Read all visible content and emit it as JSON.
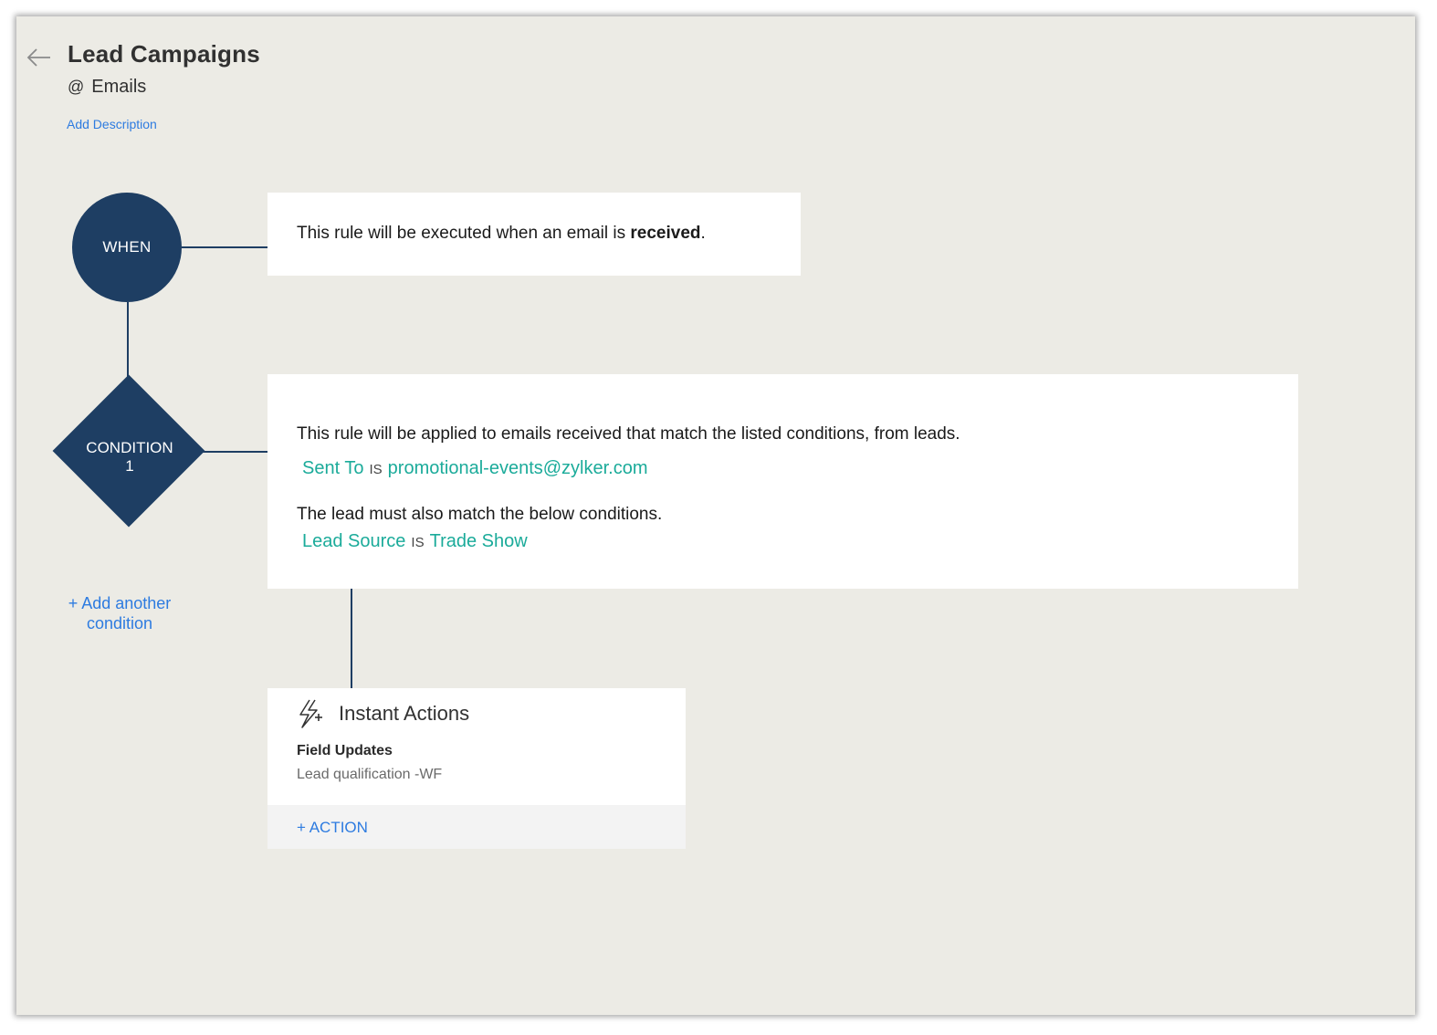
{
  "header": {
    "title": "Lead Campaigns",
    "subtitle_prefix": "@",
    "subtitle": "Emails",
    "add_description": "Add Description"
  },
  "when": {
    "node_label": "WHEN",
    "text_prefix": "This rule will be executed when an email is ",
    "text_bold": "received",
    "text_suffix": "."
  },
  "condition": {
    "node_label_line1": "CONDITION",
    "node_label_line2": "1",
    "intro": "This rule will be applied to emails received that match the listed conditions, from leads.",
    "criteria1": {
      "field": "Sent To",
      "operator": "IS",
      "value": "promotional-events@zylker.com"
    },
    "lead_intro": "The lead must also match the below conditions.",
    "criteria2": {
      "field": "Lead Source",
      "operator": "IS",
      "value": "Trade Show"
    },
    "add_another_line1": "+ Add another",
    "add_another_line2": "condition"
  },
  "actions": {
    "title": "Instant Actions",
    "icon": "lightning-plus-icon",
    "field_updates_label": "Field Updates",
    "field_updates_value": "Lead qualification -WF",
    "add_action": "+ ACTION"
  },
  "colors": {
    "node": "#1e3e63",
    "link": "#2d7be0",
    "criteria": "#1bab9a",
    "canvas": "#ecebe5"
  }
}
